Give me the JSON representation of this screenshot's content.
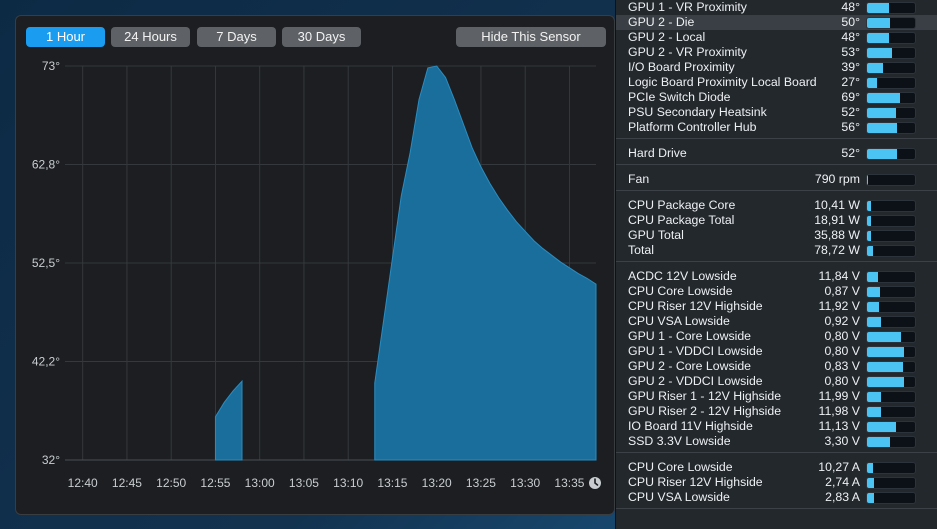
{
  "history": {
    "ranges": [
      {
        "label": "1 Hour",
        "active": true
      },
      {
        "label": "24 Hours",
        "active": false
      },
      {
        "label": "7 Days",
        "active": false
      },
      {
        "label": "30 Days",
        "active": false
      }
    ],
    "hide_button": "Hide This Sensor",
    "y_ticks": [
      "73°",
      "62,8°",
      "52,5°",
      "42,2°",
      "32°"
    ],
    "x_ticks": [
      "12:40",
      "12:45",
      "12:50",
      "12:55",
      "13:00",
      "13:05",
      "13:10",
      "13:15",
      "13:20",
      "13:25",
      "13:30",
      "13:35"
    ],
    "clock_icon": "clock-icon"
  },
  "chart_data": {
    "type": "area",
    "title": "",
    "xlabel": "",
    "ylabel": "",
    "ylim": [
      32,
      73
    ],
    "x_range": [
      "12:38",
      "13:38"
    ],
    "grid": true,
    "color": "#1a6e9c",
    "segments": [
      {
        "x": [
          "12:55",
          "12:55",
          "12:56",
          "12:57",
          "12:58",
          "12:58"
        ],
        "y": [
          36.5,
          36.5,
          38.0,
          39.2,
          40.2,
          40.2
        ]
      },
      {
        "x": [
          "13:13",
          "13:13",
          "13:14",
          "13:15",
          "13:16",
          "13:17",
          "13:18",
          "13:19",
          "13:20",
          "13:21",
          "13:22",
          "13:23",
          "13:24",
          "13:25",
          "13:26",
          "13:27",
          "13:28",
          "13:29",
          "13:30",
          "13:31",
          "13:32",
          "13:33",
          "13:34",
          "13:35",
          "13:36",
          "13:37",
          "13:38"
        ],
        "y": [
          36.8,
          40.0,
          46.5,
          53.0,
          59.5,
          64.0,
          69.5,
          72.8,
          73.0,
          71.8,
          69.5,
          67.0,
          64.5,
          62.5,
          60.8,
          59.3,
          58.0,
          56.8,
          55.8,
          54.8,
          54.0,
          53.3,
          52.6,
          52.0,
          51.4,
          50.9,
          50.3
        ]
      }
    ]
  },
  "sensors": {
    "groups": [
      {
        "rows": [
          {
            "name": "GPU 1 - VR Proximity",
            "value": "48°",
            "level": 0.45
          },
          {
            "name": "GPU 2 - Die",
            "value": "50°",
            "level": 0.47,
            "highlight": true
          },
          {
            "name": "GPU 2 - Local",
            "value": "48°",
            "level": 0.45
          },
          {
            "name": "GPU 2 - VR Proximity",
            "value": "53°",
            "level": 0.52
          },
          {
            "name": "I/O Board Proximity",
            "value": "39°",
            "level": 0.33
          },
          {
            "name": "Logic Board Proximity Local Board",
            "value": "27°",
            "level": 0.2
          },
          {
            "name": "PCIe Switch Diode",
            "value": "69°",
            "level": 0.68
          },
          {
            "name": "PSU Secondary Heatsink",
            "value": "52°",
            "level": 0.6
          },
          {
            "name": "Platform Controller Hub",
            "value": "56°",
            "level": 0.62
          }
        ]
      },
      {
        "rows": [
          {
            "name": "Hard Drive",
            "value": "52°",
            "level": 0.62
          }
        ]
      },
      {
        "rows": [
          {
            "name": "Fan",
            "value": "790 rpm",
            "level": 0.02
          }
        ]
      },
      {
        "rows": [
          {
            "name": "CPU Package Core",
            "value": "10,41 W",
            "level": 0.08
          },
          {
            "name": "CPU Package Total",
            "value": "18,91 W",
            "level": 0.08
          },
          {
            "name": "GPU Total",
            "value": "35,88 W",
            "level": 0.08
          },
          {
            "name": "Total",
            "value": "78,72 W",
            "level": 0.12
          }
        ]
      },
      {
        "rows": [
          {
            "name": "ACDC 12V Lowside",
            "value": "11,84 V",
            "level": 0.22
          },
          {
            "name": "CPU Core Lowside",
            "value": "0,87 V",
            "level": 0.28
          },
          {
            "name": "CPU Riser 12V Highside",
            "value": "11,92 V",
            "level": 0.25
          },
          {
            "name": "CPU VSA Lowside",
            "value": "0,92 V",
            "level": 0.3
          },
          {
            "name": "GPU 1 - Core Lowside",
            "value": "0,80 V",
            "level": 0.7
          },
          {
            "name": "GPU 1 - VDDCI Lowside",
            "value": "0,80 V",
            "level": 0.78
          },
          {
            "name": "GPU 2 - Core Lowside",
            "value": "0,83 V",
            "level": 0.74
          },
          {
            "name": "GPU 2 - VDDCI Lowside",
            "value": "0,80 V",
            "level": 0.78
          },
          {
            "name": "GPU Riser 1 - 12V Highside",
            "value": "11,99 V",
            "level": 0.3
          },
          {
            "name": "GPU Riser 2 - 12V Highside",
            "value": "11,98 V",
            "level": 0.3
          },
          {
            "name": "IO Board 11V Highside",
            "value": "11,13 V",
            "level": 0.6
          },
          {
            "name": "SSD 3.3V Lowside",
            "value": "3,30 V",
            "level": 0.48
          }
        ]
      },
      {
        "rows": [
          {
            "name": "CPU Core Lowside",
            "value": "10,27 A",
            "level": 0.12
          },
          {
            "name": "CPU Riser 12V Highside",
            "value": "2,74 A",
            "level": 0.14
          },
          {
            "name": "CPU VSA Lowside",
            "value": "2,83 A",
            "level": 0.14
          }
        ]
      }
    ]
  }
}
